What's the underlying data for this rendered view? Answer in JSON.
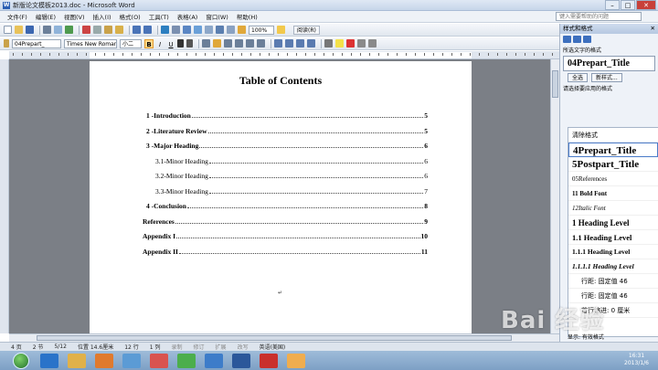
{
  "window": {
    "title": "新版论文模板2013.doc - Microsoft Word",
    "minimize": "–",
    "maximize": "□",
    "close": "✕"
  },
  "menu": {
    "items": [
      "文件(F)",
      "编辑(E)",
      "视图(V)",
      "插入(I)",
      "格式(O)",
      "工具(T)",
      "表格(A)",
      "窗口(W)",
      "帮助(H)"
    ],
    "help_placeholder": "键入需要帮助的问题"
  },
  "toolbar": {
    "zoom": "100%",
    "read_label": "阅读(R)"
  },
  "format_bar": {
    "style": "04Prepart_",
    "font": "Times New Roman",
    "size": "小二",
    "bold": "B",
    "italic": "I",
    "underline": "U"
  },
  "document": {
    "title": "Table of Contents",
    "toc": [
      {
        "label": "1 -Introduction",
        "page": "5"
      },
      {
        "label": "2 -Literature Review",
        "page": "5"
      },
      {
        "label": "3 -Major Heading",
        "page": "6"
      },
      {
        "label": "3.1-Minor Heading",
        "page": "6"
      },
      {
        "label": "3.2-Minor Heading",
        "page": "6"
      },
      {
        "label": "3.3-Minor Heading",
        "page": "7"
      },
      {
        "label": "4 -Conclusion",
        "page": "8"
      },
      {
        "label": "References",
        "page": "9"
      },
      {
        "label": "Appendix I",
        "page": "10"
      },
      {
        "label": "Appendix II",
        "page": "11"
      }
    ]
  },
  "status": {
    "page": "4 页",
    "section": "2 节",
    "pages": "5/12",
    "position": "位置 14.6厘米",
    "line": "12 行",
    "col": "1 列",
    "rec": "录制",
    "trk": "修订",
    "ext": "扩展",
    "ovr": "改写",
    "lang": "英语(美国)"
  },
  "taskpane": {
    "title": "样式和格式",
    "close": "✕",
    "selected_label": "所选文字的格式",
    "current_style": "04Prepart_Title",
    "select_all": "全选",
    "new_style": "新样式...",
    "apply_label": "请选择要应用的格式",
    "styles": [
      "清除格式",
      "4Prepart_Title",
      "5Postpart_Title",
      "05References",
      "11 Bold Font",
      "12Italic Font",
      "1  Heading Level",
      "1.1  Heading Level",
      "1.1.1  Heading Level",
      "1.1.1.1  Heading Level",
      "行距: 固定值 46",
      "行距: 固定值 46",
      "首行缩进: 0 厘米"
    ],
    "show_label": "显示: 有效格式"
  },
  "taskbar": {
    "time": "16:31",
    "date": "2013/1/6"
  },
  "watermark": "Bai 经验"
}
